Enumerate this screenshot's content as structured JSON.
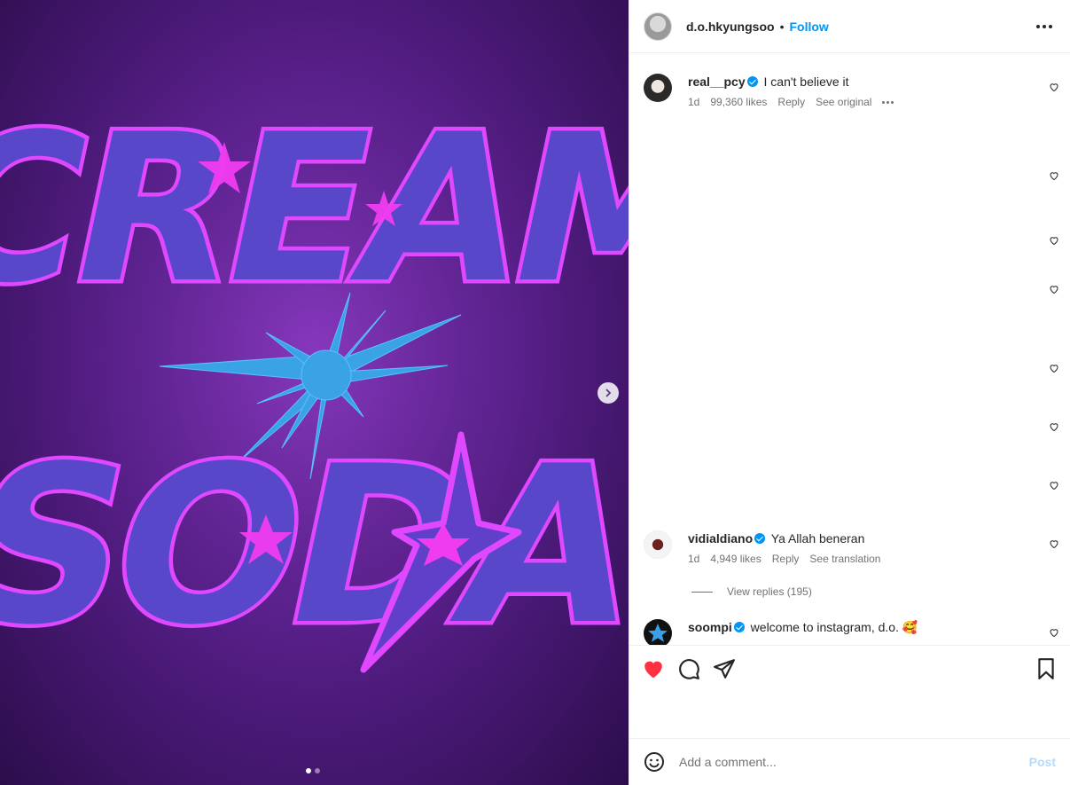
{
  "media": {
    "image_text_line1": "CREAM",
    "image_text_line2": "SODA",
    "next_icon": "chevron-right-icon",
    "carousel_count": 2,
    "carousel_active": 1
  },
  "header": {
    "username": "d.o.hkyungsoo",
    "separator": "•",
    "follow_label": "Follow",
    "more_icon": "ellipsis-icon"
  },
  "comments": [
    {
      "username": "real__pcy",
      "verified": true,
      "text": "I can't believe it",
      "time": "1d",
      "likes": "99,360 likes",
      "reply": "Reply",
      "extra": "See original"
    },
    {
      "username": "vidialdiano",
      "verified": true,
      "text": "Ya Allah beneran",
      "time": "1d",
      "likes": "4,949 likes",
      "reply": "Reply",
      "extra": "See translation",
      "view_replies": "View replies (195)"
    },
    {
      "username": "soompi",
      "verified": true,
      "text": "welcome to instagram, d.o. 🥰"
    }
  ],
  "actions": {
    "like_icon": "heart-filled-icon",
    "comment_icon": "comment-bubble-icon",
    "share_icon": "paper-plane-icon",
    "save_icon": "bookmark-icon",
    "like_color": "#ff3040"
  },
  "composer": {
    "emoji_icon": "smiley-icon",
    "placeholder": "Add a comment...",
    "post_label": "Post"
  },
  "colors": {
    "accent": "#0095f6",
    "muted": "#737373"
  }
}
